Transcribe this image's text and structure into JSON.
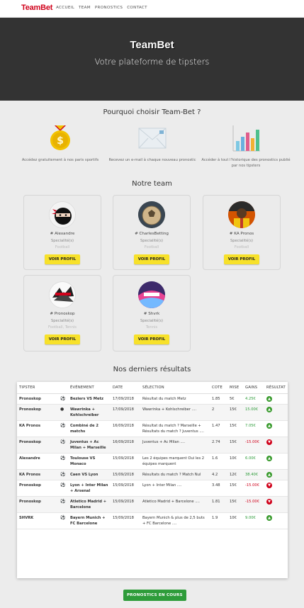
{
  "nav": {
    "logo": "TeamBet",
    "links": [
      "ACCUEIL",
      "TEAM",
      "PRONOSTICS",
      "CONTACT"
    ]
  },
  "hero": {
    "title": "TeamBet",
    "subtitle": "Votre plateforme de tipsters"
  },
  "why": {
    "title": "Pourquoi choisir Team-Bet ?",
    "features": [
      {
        "icon": "coin-dollar-icon",
        "text": "Accédez gratuitement à nos paris sportifs"
      },
      {
        "icon": "envelope-icon",
        "text": "Recevez un e-mail à chaque nouveau pronostic"
      },
      {
        "icon": "bar-chart-icon",
        "text": "Accéder à tout l'historique des pronostics publié par nos tipsters"
      }
    ]
  },
  "team": {
    "title": "Notre team",
    "members": [
      {
        "name": "# Alexandre",
        "spec_label": "Specialité(s)",
        "sports": "Football",
        "button": "VOIR PROFIL",
        "avatar": "ninja-avatar"
      },
      {
        "name": "# CharlesBetting",
        "spec_label": "Specialité(s)",
        "sports": "Football",
        "button": "VOIR PROFIL",
        "avatar": "football-avatar"
      },
      {
        "name": "# KA Pronos",
        "spec_label": "Specialité(s)",
        "sports": "Football",
        "button": "VOIR PROFIL",
        "avatar": "player-avatar"
      },
      {
        "name": "# Pronoskop",
        "spec_label": "Specialité(s)",
        "sports": "Football, Tennis",
        "button": "VOIR PROFIL",
        "avatar": "pronoskop-avatar"
      },
      {
        "name": "# Shvrk",
        "spec_label": "Specialité(s)",
        "sports": "Tennis",
        "button": "VOIR PROFIL",
        "avatar": "shvrk-avatar"
      }
    ]
  },
  "results": {
    "title": "Nos derniers résultats",
    "headers": [
      "TIPSTER",
      "",
      "ÉVÉNEMENT",
      "DATE",
      "SÉLECTION",
      "COTE",
      "MISE",
      "GAINS",
      "RÉSULTAT"
    ],
    "rows": [
      {
        "tipster": "Pronoskop",
        "sport": "football",
        "event": "Beziers VS Metz",
        "date": "17/09/2018",
        "selection": "Résultat du match Metz",
        "cote": "1.85",
        "mise": "5€",
        "gains": "4.25€",
        "result": "win"
      },
      {
        "tipster": "Pronoskop",
        "sport": "tennis",
        "event": "Wawrinka + Kohlschreiber",
        "date": "17/09/2018",
        "selection": "Wawrinka + Kohlschreiber ....",
        "cote": "2",
        "mise": "15€",
        "gains": "15.00€",
        "result": "win"
      },
      {
        "tipster": "KA Pronos",
        "sport": "football",
        "event": "Combiné de 2 matchs",
        "date": "16/09/2018",
        "selection": "Résultat du match ? Marseille + Résultats du match ? Juventus ....",
        "cote": "1.47",
        "mise": "15€",
        "gains": "7.05€",
        "result": "win"
      },
      {
        "tipster": "Pronoskop",
        "sport": "football",
        "event": "Juventus + Ac Milan + Marseille",
        "date": "16/09/2018",
        "selection": "Juventus + Ac Milan ....",
        "cote": "2.74",
        "mise": "15€",
        "gains": "-15.00€",
        "result": "lose"
      },
      {
        "tipster": "Alexandre",
        "sport": "football",
        "event": "Toulouse VS Monaco",
        "date": "15/09/2018",
        "selection": "Les 2 équipes marquent Oui les 2 équipes marquent",
        "cote": "1.6",
        "mise": "10€",
        "gains": "6.00€",
        "result": "win"
      },
      {
        "tipster": "KA Pronos",
        "sport": "football",
        "event": "Caen VS Lyon",
        "date": "15/09/2018",
        "selection": "Résultats du match ? Match Nul",
        "cote": "4.2",
        "mise": "12€",
        "gains": "38.40€",
        "result": "win"
      },
      {
        "tipster": "Pronoskop",
        "sport": "football",
        "event": "Lyon + Inter Milan + Arsenal",
        "date": "15/09/2018",
        "selection": "Lyon + Inter Milan ....",
        "cote": "3.48",
        "mise": "15€",
        "gains": "-15.00€",
        "result": "lose"
      },
      {
        "tipster": "Pronoskop",
        "sport": "football",
        "event": "Atletico Madrid + Barcelone",
        "date": "15/09/2018",
        "selection": "Atletico Madrid + Barcelone ....",
        "cote": "1.81",
        "mise": "15€",
        "gains": "-15.00€",
        "result": "lose"
      },
      {
        "tipster": "SHVRK",
        "sport": "football",
        "event": "Bayern Munich + FC Barcelone",
        "date": "15/09/2018",
        "selection": "Bayern Munich & plus de 2,5 buts + FC Barcelone ....",
        "cote": "1.9",
        "mise": "10€",
        "gains": "9.00€",
        "result": "win"
      }
    ]
  },
  "cta": {
    "label": "PRONOSTICS EN COURS"
  },
  "colors": {
    "brand": "#d0021b",
    "yellow": "#f7e12a",
    "green": "#2e9c3a",
    "dark": "#333333"
  }
}
